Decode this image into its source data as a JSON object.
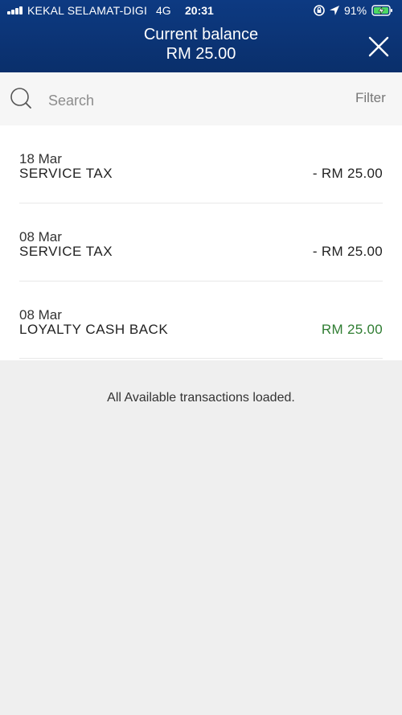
{
  "status_bar": {
    "carrier": "KEKAL SELAMAT-DIGI",
    "network": "4G",
    "time": "20:31",
    "battery": "91%",
    "icons": [
      "signal-icon",
      "rotation-lock-icon",
      "location-arrow-icon",
      "battery-charging-icon"
    ]
  },
  "header": {
    "title": "Current balance",
    "amount": "RM 25.00",
    "close_icon": "close-icon",
    "colors": {
      "background": "#0a2f6b"
    }
  },
  "search": {
    "placeholder": "Search",
    "value": "",
    "filter_label": "Filter",
    "icon": "search-icon"
  },
  "transactions": [
    {
      "date": "18 Mar",
      "description": "SERVICE TAX",
      "amount": "- RM 25.00",
      "type": "debit"
    },
    {
      "date": "08 Mar",
      "description": "SERVICE TAX",
      "amount": "- RM 25.00",
      "type": "debit"
    },
    {
      "date": "08 Mar",
      "description": "LOYALTY CASH BACK",
      "amount": "RM 25.00",
      "type": "credit"
    }
  ],
  "footer_message": "All Available transactions loaded.",
  "colors": {
    "credit": "#2f7d32",
    "debit": "#222222",
    "page_background": "#efefef"
  }
}
